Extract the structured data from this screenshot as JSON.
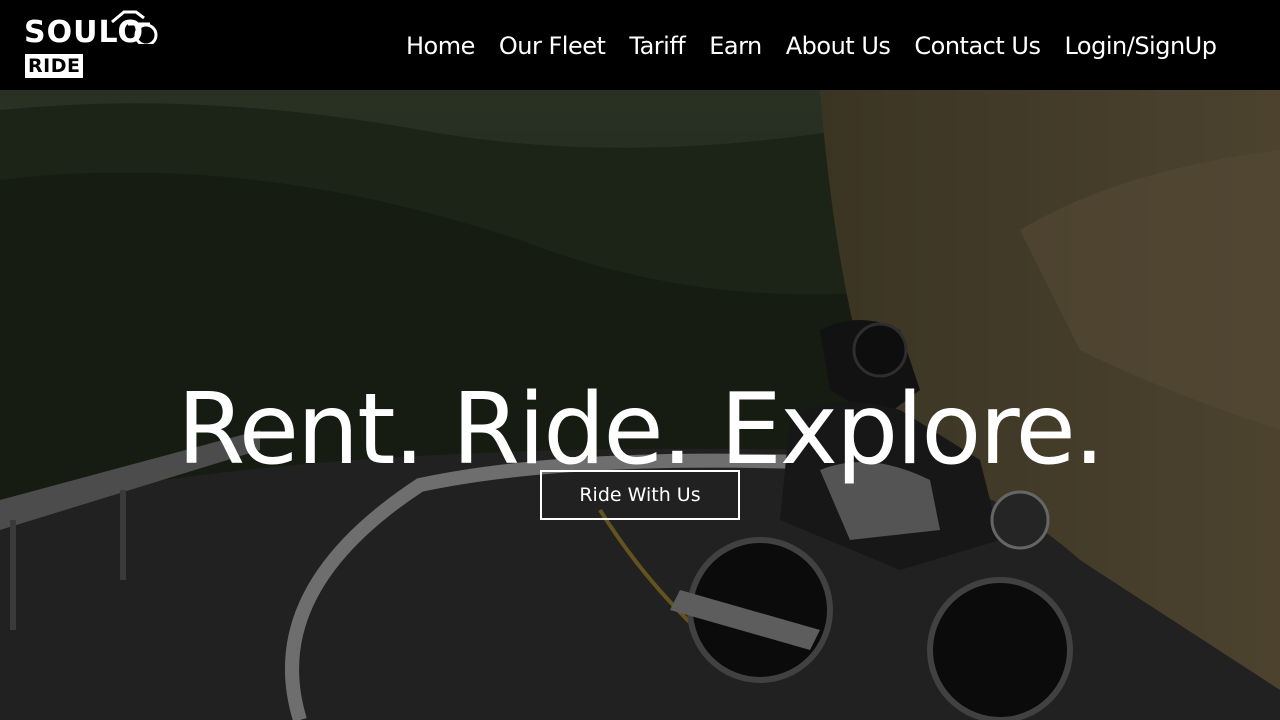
{
  "brand": {
    "name": "SOULO",
    "sub": "RIDE"
  },
  "nav": {
    "items": [
      "Home",
      "Our Fleet",
      "Tariff",
      "Earn",
      "About Us",
      "Contact Us",
      "Login/SignUp"
    ]
  },
  "hero": {
    "title": "Rent. Ride. Explore.",
    "cta_label": "Ride With Us"
  },
  "colors": {
    "header_bg": "#000000",
    "text": "#ffffff"
  }
}
